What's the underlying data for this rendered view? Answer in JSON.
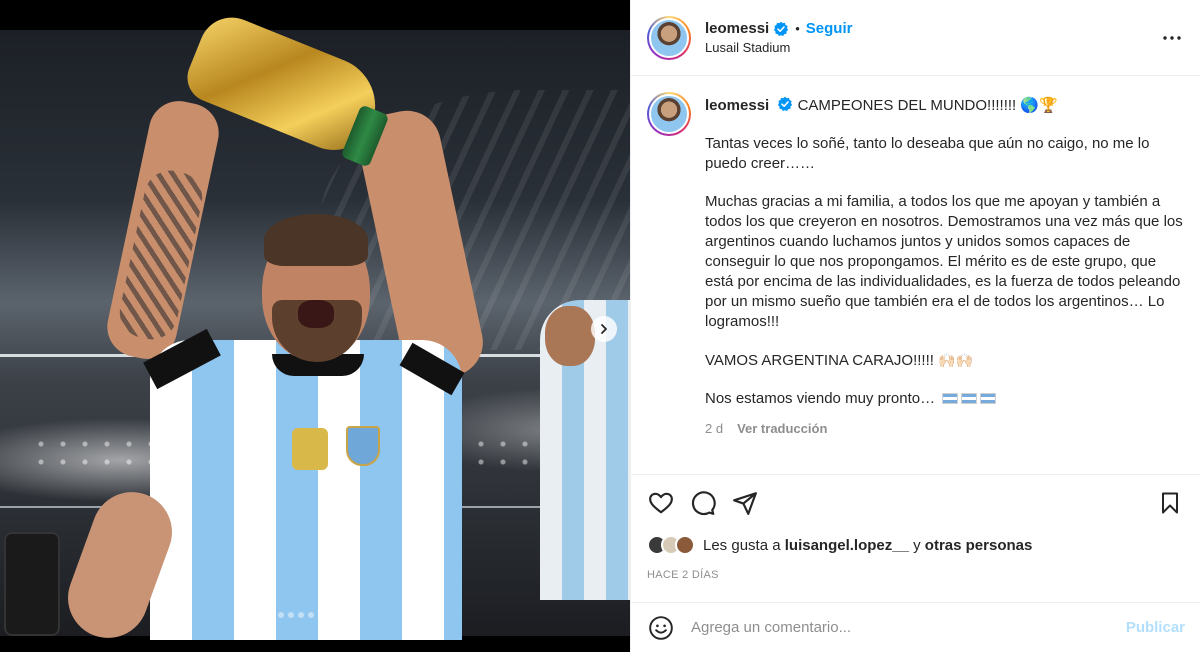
{
  "post": {
    "author": {
      "username": "leomessi",
      "verified": true,
      "follow_label": "Seguir",
      "location": "Lusail Stadium"
    },
    "more_icon": "ellipsis-horizontal-icon",
    "media": {
      "carousel_dots": 8,
      "active_dot": 0,
      "next_icon": "chevron-right-icon"
    },
    "caption": {
      "username": "leomessi",
      "headline": "CAMPEONES DEL MUNDO!!!!!!! 🌎🏆",
      "paragraph_1": "Tantas veces lo soñé, tanto lo deseaba que aún no caigo, no me lo puedo creer……",
      "paragraph_2": "Muchas gracias a mi familia, a todos los que me apoyan y también a todos los que creyeron en nosotros. Demostramos una vez más que los argentinos cuando luchamos juntos y unidos somos capaces de conseguir lo que nos propongamos. El mérito es de este grupo, que está por encima de las individualidades, es la fuerza de todos peleando por un mismo sueño que también era el de todos los argentinos… Lo logramos!!!",
      "paragraph_3": "VAMOS ARGENTINA CARAJO!!!!!",
      "paragraph_3_emoji": "🙌🏻🙌🏻",
      "paragraph_4": "Nos estamos viendo muy pronto…",
      "time": "2 d",
      "translate_label": "Ver traducción"
    },
    "actions": {
      "like_icon": "heart-icon",
      "comment_icon": "comment-icon",
      "share_icon": "send-icon",
      "save_icon": "bookmark-icon"
    },
    "likes": {
      "prefix": "Les gusta a",
      "user": "luisangel.lopez__",
      "connector": "y",
      "others": "otras personas"
    },
    "timestamp": "HACE 2 DÍAS",
    "comment": {
      "emoji_icon": "smiley-icon",
      "placeholder": "Agrega un comentario...",
      "publish_label": "Publicar"
    }
  },
  "colors": {
    "accent": "#0095f6",
    "publish_disabled": "#b2dffc",
    "text": "#262626",
    "muted": "#8e8e8e"
  }
}
